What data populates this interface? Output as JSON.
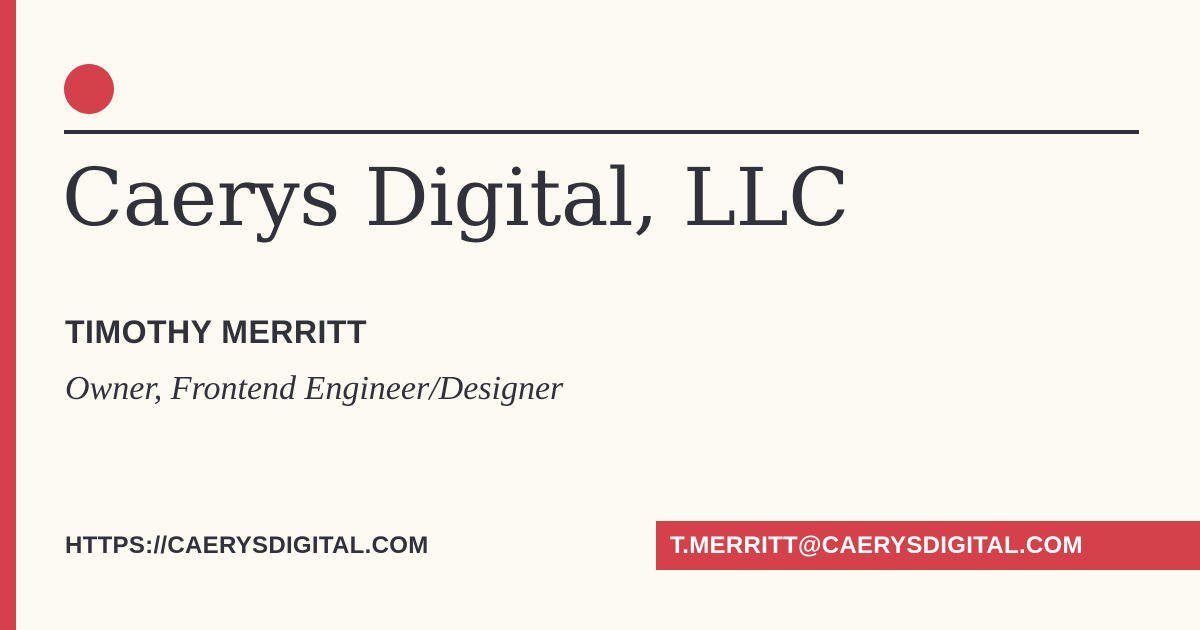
{
  "card": {
    "company_name": "Caerys Digital, LLC",
    "person_name": "TIMOTHY MERRITT",
    "person_title": "Owner, Frontend Engineer/Designer",
    "website": "HTTPS://CAERYSDIGITAL.COM",
    "email": "T.MERRITT@CAERYSDIGITAL.COM"
  },
  "colors": {
    "background": "#fdfaf2",
    "accent": "#d4414a",
    "text": "#31313c",
    "badge_text": "#ffffff"
  },
  "icons": {
    "brand_dot": "circle"
  }
}
